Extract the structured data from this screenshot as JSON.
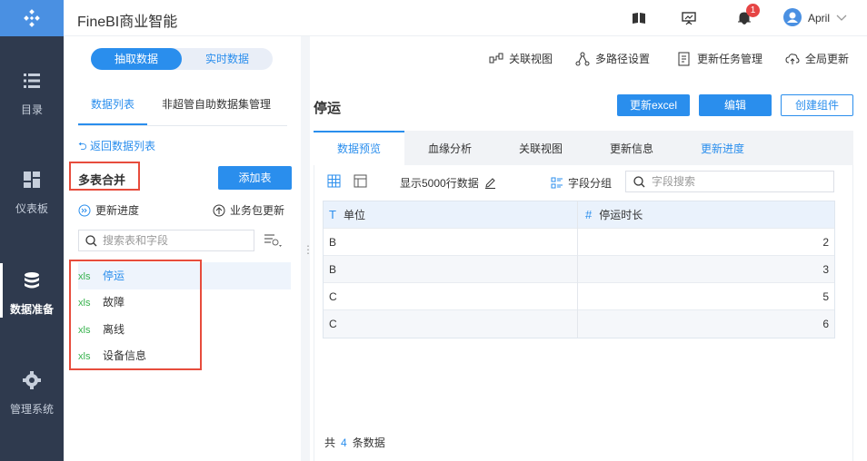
{
  "app": {
    "title": "FineBI商业智能"
  },
  "user": {
    "name": "April",
    "notification_count": "1"
  },
  "nav": {
    "items": [
      {
        "label": "目录",
        "icon": "list-icon"
      },
      {
        "label": "仪表板",
        "icon": "dashboard-icon"
      },
      {
        "label": "数据准备",
        "icon": "database-icon",
        "active": true
      },
      {
        "label": "管理系统",
        "icon": "gear-icon"
      }
    ]
  },
  "mode_toggle": {
    "on": "抽取数据",
    "off": "实时数据"
  },
  "toolbar": {
    "relation_view": "关联视图",
    "multipath": "多路径设置",
    "update_task": "更新任务管理",
    "global_update": "全局更新"
  },
  "left_panel": {
    "tabs": [
      "数据列表",
      "非超管自助数据集管理"
    ],
    "back": "返回数据列表",
    "group_title": "多表合并",
    "add_button": "添加表",
    "progress": "更新进度",
    "pkg_update": "业务包更新",
    "search_placeholder": "搜索表和字段",
    "tables": [
      {
        "tag": "xls",
        "name": "停运",
        "active": true
      },
      {
        "tag": "xls",
        "name": "故障"
      },
      {
        "tag": "xls",
        "name": "离线"
      },
      {
        "tag": "xls",
        "name": "设备信息"
      }
    ]
  },
  "right_panel": {
    "title": "停运",
    "buttons": {
      "update_excel": "更新excel",
      "edit": "编辑",
      "create_component": "创建组件"
    },
    "tabs": [
      "数据预览",
      "血缘分析",
      "关联视图",
      "更新信息",
      "更新进度"
    ],
    "show_rows": "显示5000行数据",
    "field_group": "字段分组",
    "field_search_placeholder": "字段搜索",
    "columns": [
      {
        "type": "T",
        "name": "单位"
      },
      {
        "type": "#",
        "name": "停运时长"
      }
    ],
    "rows": [
      [
        "B",
        "2"
      ],
      [
        "B",
        "3"
      ],
      [
        "C",
        "5"
      ],
      [
        "C",
        "6"
      ]
    ],
    "footer": {
      "prefix": "共",
      "count": "4",
      "suffix": "条数据"
    }
  },
  "colors": {
    "accent": "#2a8eed",
    "nav_bg": "#2f3a4e",
    "highlight": "#e74c3c"
  }
}
